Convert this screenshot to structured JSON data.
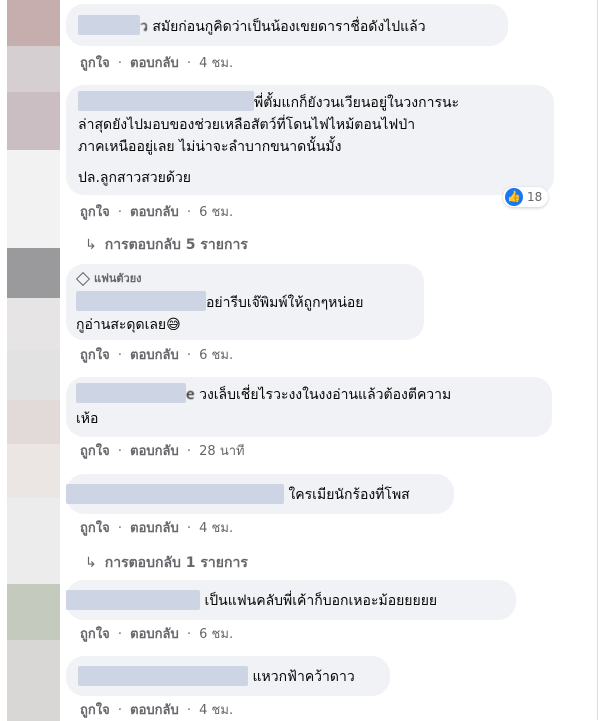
{
  "common": {
    "like_label": "ถูกใจ",
    "reply_label": "ตอบกลับ",
    "dot": "·"
  },
  "comments": [
    {
      "text": "สมัยก่อนกูคิดว่าเป็นน้องเขยดาราชื่อดังไปแล้ว",
      "name_fragment": "ว",
      "time": "4 ชม."
    },
    {
      "lines": [
        "พี่ตั้มแกก็ยังวนเวียนอยู่ในวงการนะ",
        "ล่าสุดยังไปมอบของช่วยเหลือสัตว์ที่โดนไฟไหม้ตอนไฟป่า",
        "ภาคเหนืออยู่เลย ไม่น่าจะลำบากขนาดนั้นมั้ง",
        "ปล.ลูกสาวสวยด้วย"
      ],
      "reaction_count": "18",
      "reaction_icon": "like-icon",
      "time": "6 ชม.",
      "replies_label": "การตอบกลับ 5 รายการ"
    },
    {
      "badge": "แฟนตัวยง",
      "badge_icon": "diamond-icon",
      "lines": [
        "อย่ารีบเจ๊พิมพ์ให้ถูกๆหน่อย",
        "กูอ่านสะดุดเลย😅"
      ],
      "time": "6 ชม."
    },
    {
      "name_fragment": "e",
      "lines": [
        "วงเล็บเชี่ยไรวะงงในงงอ่านแล้วต้องตีความ",
        "เห้อ"
      ],
      "time": "28 นาที"
    },
    {
      "text": "ใครเมียนักร้องที่โพส",
      "time": "4 ชม.",
      "replies_label": "การตอบกลับ 1 รายการ"
    },
    {
      "text": "เป็นแฟนคลับพี่เค้าก็บอกเหอะม้อยยยยย",
      "time": "6 ชม."
    },
    {
      "text": "แหวกฟ้าคว้าดาว",
      "time": "4 ชม."
    }
  ]
}
